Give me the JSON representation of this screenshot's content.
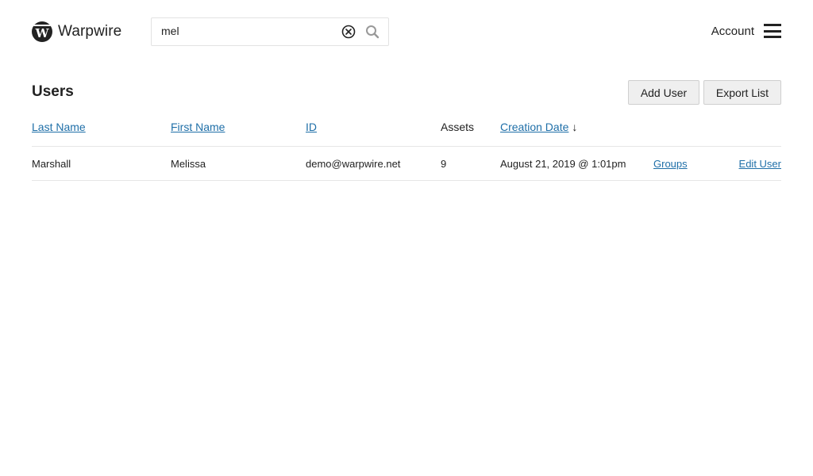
{
  "brand": {
    "name": "Warpwire",
    "logo_letter": "W"
  },
  "search": {
    "value": "mel",
    "placeholder": "",
    "clear_icon": "circle-x-icon",
    "search_icon": "magnifier-icon"
  },
  "account": {
    "label": "Account",
    "menu_icon": "hamburger-icon"
  },
  "page": {
    "title": "Users"
  },
  "toolbar": {
    "add_user_label": "Add User",
    "export_list_label": "Export List"
  },
  "table": {
    "columns": [
      {
        "label": "Last Name",
        "sortable": true
      },
      {
        "label": "First Name",
        "sortable": true
      },
      {
        "label": "ID",
        "sortable": true
      },
      {
        "label": "Assets",
        "sortable": false
      },
      {
        "label": "Creation Date",
        "sortable": true,
        "sort_indicator": "↓"
      }
    ],
    "rows": [
      {
        "last_name": "Marshall",
        "first_name": "Melissa",
        "id": "demo@warpwire.net",
        "assets": "9",
        "creation_date": "August 21, 2019 @ 1:01pm",
        "groups_link": "Groups",
        "edit_link": "Edit User"
      }
    ]
  },
  "colors": {
    "link": "#1f6fa8",
    "text": "#222222",
    "button_bg": "#efefef"
  }
}
